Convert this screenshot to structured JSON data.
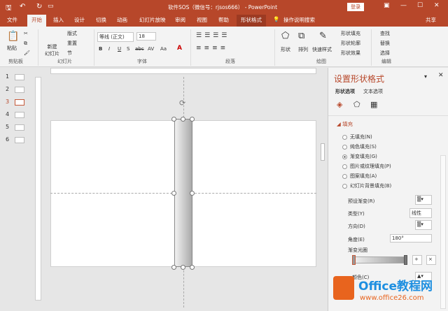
{
  "titlebar": {
    "title": "软件SOS（微信号：rjsos666） - PowerPoint",
    "login": "登录"
  },
  "tabs": [
    "文件",
    "开始",
    "插入",
    "设计",
    "切换",
    "动画",
    "幻灯片放映",
    "审阅",
    "视图",
    "帮助",
    "形状格式"
  ],
  "tell_me": "操作说明搜索",
  "share": "共享",
  "ribbon": {
    "clipboard": {
      "paste": "粘贴",
      "group": "剪贴板"
    },
    "slides": {
      "new": "新建\n幻灯片",
      "layout": "版式",
      "reset": "重置",
      "section": "节",
      "group": "幻灯片"
    },
    "font": {
      "name": "等线 (正文)",
      "size": "18",
      "group": "字体",
      "bold": "B",
      "italic": "I",
      "underline": "U",
      "shadow": "S",
      "strike": "abc",
      "spacing": "AV",
      "case": "Aa"
    },
    "paragraph": {
      "group": "段落"
    },
    "drawing": {
      "shapes": "形状",
      "arrange": "排列",
      "quick": "快速样式",
      "fill": "形状填充",
      "outline": "形状轮廓",
      "effects": "形状效果",
      "group": "绘图"
    },
    "editing": {
      "find": "查找",
      "replace": "替换",
      "select": "选择",
      "group": "编辑"
    }
  },
  "thumbnails": [
    "1",
    "2",
    "3",
    "4",
    "5",
    "6"
  ],
  "pane": {
    "title": "设置形状格式",
    "tab_shape": "形状选项",
    "tab_text": "文本选项",
    "section": "填充",
    "options": [
      {
        "label": "无填充(N)",
        "checked": false
      },
      {
        "label": "纯色填充(S)",
        "checked": false
      },
      {
        "label": "渐变填充(G)",
        "checked": true
      },
      {
        "label": "图片或纹理填充(P)",
        "checked": false
      },
      {
        "label": "图案填充(A)",
        "checked": false
      },
      {
        "label": "幻灯片背景填充(B)",
        "checked": false
      }
    ],
    "preset": "预设渐变(R)",
    "type_label": "类型(Y)",
    "type_value": "线性",
    "direction": "方向(D)",
    "angle_label": "角度(E)",
    "angle_value": "180°",
    "stops": "渐变光圈",
    "color": "颜色(C)"
  },
  "watermark": {
    "brand": "Office教程网",
    "url": "www.office26.com"
  }
}
